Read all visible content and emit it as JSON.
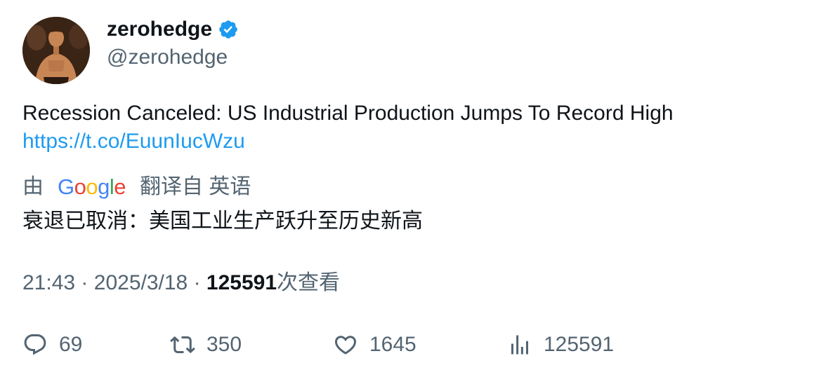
{
  "author": {
    "display_name": "zerohedge",
    "handle": "@zerohedge",
    "verified": true,
    "avatar_icon": "avatar-photo"
  },
  "tweet": {
    "text": "Recession Canceled: US Industrial Production Jumps To Record High",
    "link": "https://t.co/EuunIucWzu"
  },
  "translation": {
    "prefix": "由",
    "provider": "Google",
    "suffix": "翻译自 英语",
    "text": "衰退已取消：美国工业生产跃升至历史新高"
  },
  "meta": {
    "time": "21:43",
    "separator": "·",
    "date": "2025/3/18",
    "views": "125591",
    "views_label": "次查看"
  },
  "actions": {
    "replies": "69",
    "retweets": "350",
    "likes": "1645",
    "views": "125591"
  },
  "colors": {
    "accent": "#1d9bf0",
    "text": "#0f1419",
    "secondary": "#536471"
  }
}
